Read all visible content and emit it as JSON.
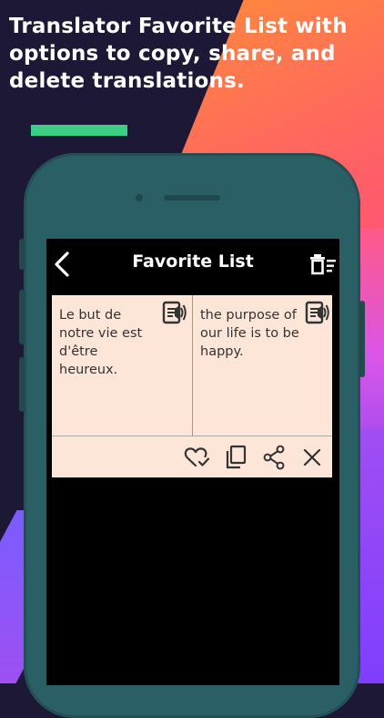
{
  "promo": {
    "headline": "Translator Favorite List with options to copy, share, and delete translations."
  },
  "colors": {
    "accent_bar": "#3bcf86",
    "card_background": "#fde6d8",
    "phone_body": "#2b5f66",
    "screen_background": "#000000"
  },
  "app": {
    "title": "Favorite List",
    "back_icon": "chevron-left-icon",
    "delete_all_icon": "trash-list-icon"
  },
  "favorites": [
    {
      "source_text": "Le but de notre vie est d'être heureux.",
      "translated_text": "the purpose of our life is to be happy.",
      "speak_icon": "speaker-document-icon",
      "actions": [
        "heart-check-icon",
        "copy-icon",
        "share-icon",
        "close-icon"
      ]
    }
  ]
}
